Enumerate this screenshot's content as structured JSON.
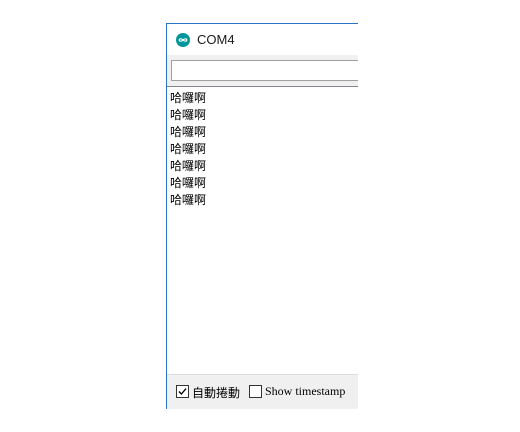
{
  "window": {
    "title": "COM4",
    "icon": "arduino-infinity-icon",
    "accent_color": "#00979c",
    "border_color": "#2b73c7"
  },
  "send_input": {
    "value": "",
    "placeholder": ""
  },
  "output": {
    "lines": [
      "哈囉啊",
      "哈囉啊",
      "哈囉啊",
      "哈囉啊",
      "哈囉啊",
      "哈囉啊",
      "哈囉啊"
    ]
  },
  "footer": {
    "autoscroll": {
      "label": "自動捲動",
      "checked": true
    },
    "timestamp": {
      "label": "Show timestamp",
      "checked": false
    }
  }
}
